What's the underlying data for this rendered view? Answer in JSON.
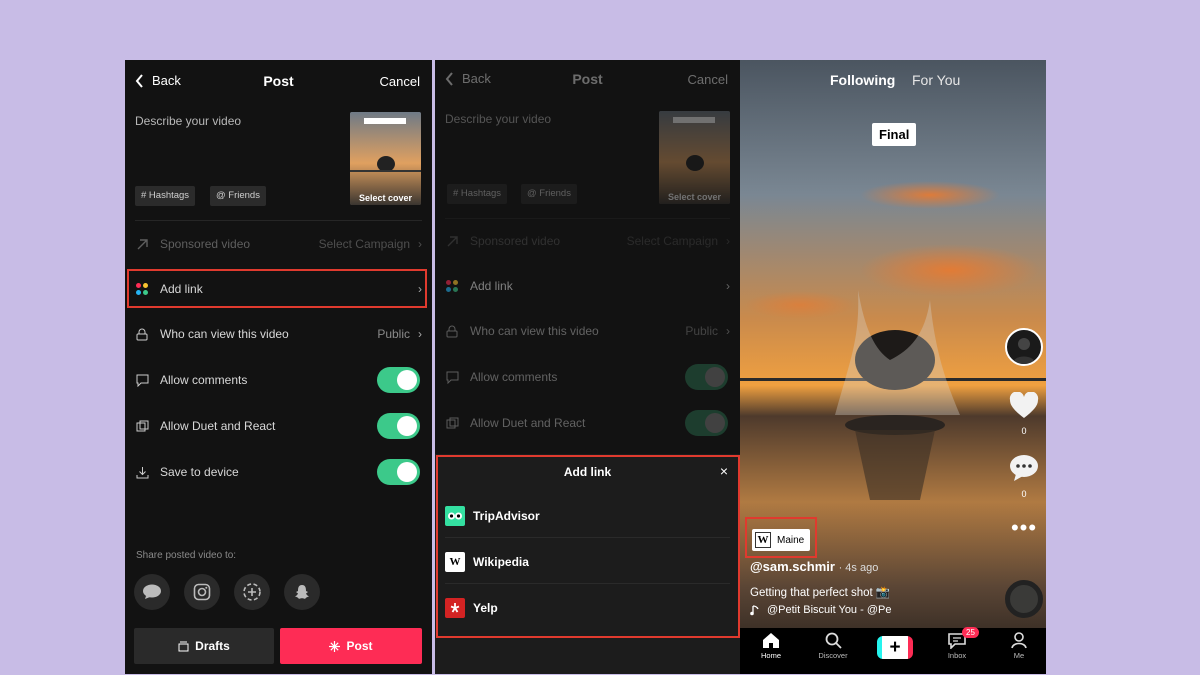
{
  "post_screen": {
    "back_label": "Back",
    "title": "Post",
    "cancel_label": "Cancel",
    "description_placeholder": "Describe your video",
    "cover_label": "Select cover",
    "hashtags_chip": "# Hashtags",
    "friends_chip": "@ Friends",
    "sponsored_label": "Sponsored video",
    "sponsored_value": "Select Campaign",
    "add_link_label": "Add link",
    "who_can_view_label": "Who can view this video",
    "who_can_view_value": "Public",
    "allow_comments_label": "Allow comments",
    "allow_duet_label": "Allow Duet and React",
    "save_device_label": "Save to device",
    "share_label": "Share posted video to:",
    "drafts_label": "Drafts",
    "post_label": "Post"
  },
  "add_link_sheet": {
    "title": "Add link",
    "close_icon": "×",
    "items": [
      {
        "label": "TripAdvisor",
        "icon": "tripadvisor-icon",
        "color": "#34e0a1"
      },
      {
        "label": "Wikipedia",
        "icon": "wikipedia-icon",
        "color": "#ffffff"
      },
      {
        "label": "Yelp",
        "icon": "yelp-icon",
        "color": "#d32323"
      }
    ]
  },
  "feed": {
    "tab_following": "Following",
    "tab_for_you": "For You",
    "overlay_text": "Final",
    "like_count": "0",
    "comment_count": "0",
    "link_chip": "Maine",
    "username": "@sam.schmir",
    "time": "· 4s ago",
    "caption": "Getting that perfect shot 📸",
    "sound": "@Petit Biscuit   You - @Pe",
    "nav": {
      "home": "Home",
      "discover": "Discover",
      "inbox": "Inbox",
      "inbox_badge": "25",
      "me": "Me"
    }
  },
  "colors": {
    "accent_red": "#fe2c55",
    "toggle_green": "#3cc98a",
    "highlight_border": "#e03a2e",
    "background": "#c8bce6"
  }
}
